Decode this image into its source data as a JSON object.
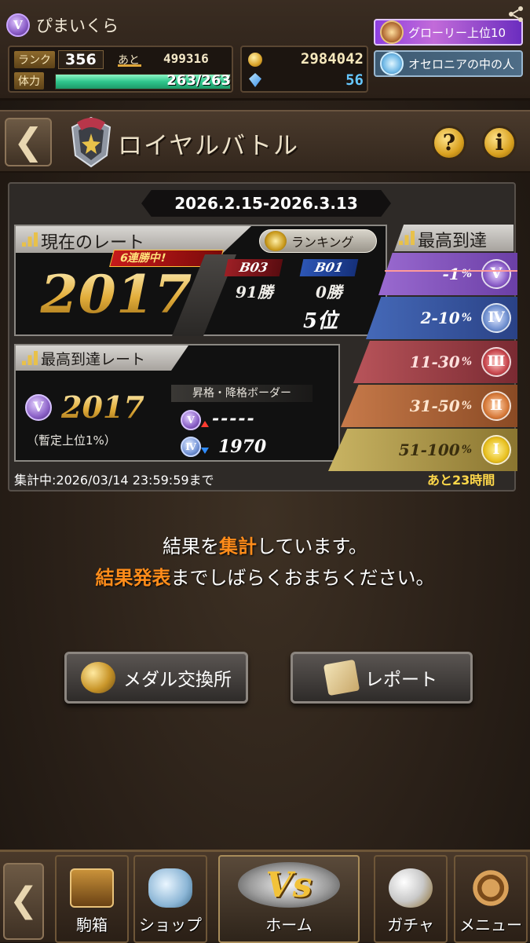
{
  "header": {
    "player_name": "ぴまいくら",
    "player_rank_letter": "V",
    "rank_label": "ランク",
    "rank_value": "356",
    "next_label": "あと",
    "next_value": "499316",
    "hp_label": "体力",
    "hp_value": "263/263",
    "hp_fraction": 1.0,
    "coins": "2984042",
    "gems": "56",
    "badge1": "グローリー上位10",
    "badge2": "オセロニアの中の人"
  },
  "title_bar": {
    "title": "ロイヤルバトル",
    "help": "?",
    "info": "i"
  },
  "season": {
    "period": "2026.2.15-2026.3.13",
    "current_rate_label": "現在のレート",
    "ranking_button": "ランキング",
    "streak": "6連勝中!",
    "current_rate": "2017",
    "bo3_label": "B03",
    "bo1_label": "B01",
    "bo3_wins": "91勝",
    "bo1_wins": "0勝",
    "place": "5位",
    "best_rate_label": "最高到達レート",
    "best_tier": "V",
    "best_rate": "2017",
    "best_percentile": "（暫定上位1%）",
    "border_label": "昇格・降格ボーダー",
    "promote_tier": "V",
    "promote_value": "-----",
    "demote_tier": "Ⅳ",
    "demote_value": "1970",
    "highest_label": "最高到達",
    "tiers": [
      {
        "range": "-1",
        "unit": "%",
        "roman": "Ⅴ"
      },
      {
        "range": "2-10",
        "unit": "%",
        "roman": "Ⅳ"
      },
      {
        "range": "11-30",
        "unit": "%",
        "roman": "Ⅲ"
      },
      {
        "range": "31-50",
        "unit": "%",
        "roman": "Ⅱ"
      },
      {
        "range": "51-100",
        "unit": "%",
        "roman": "Ⅰ"
      }
    ],
    "countdown": "集計中:2026/03/14 23:59:59まで",
    "remaining": "あと23時間"
  },
  "message": {
    "line1_a": "結果を",
    "line1_hl": "集計",
    "line1_b": "しています。",
    "line2_hl": "結果発表",
    "line2_b": "までしばらくおまちください。"
  },
  "buttons": {
    "medal_exchange": "メダル交換所",
    "report": "レポート"
  },
  "footer": {
    "box": "駒箱",
    "shop": "ショップ",
    "home": "ホーム",
    "home_vs": "Vs",
    "gacha": "ガチャ",
    "menu": "メニュー"
  },
  "colors": {
    "accent_orange": "#ff8c1a",
    "remaining_yellow": "#ffd84a",
    "hp_green": "#2fc68c"
  }
}
